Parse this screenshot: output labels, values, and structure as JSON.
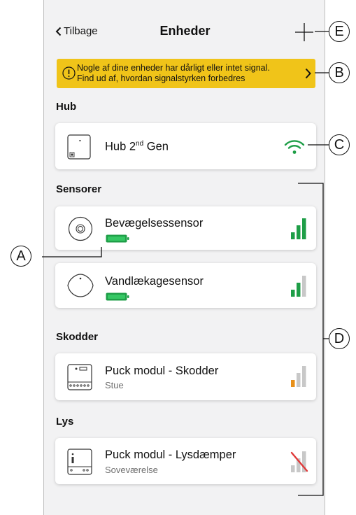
{
  "nav": {
    "back_label": "Tilbage",
    "title": "Enheder"
  },
  "banner": {
    "line1": "Nogle af dine enheder har dårligt eller intet signal.",
    "line2": "Find ud af, hvordan signalstyrken forbedres"
  },
  "sections": {
    "hub": "Hub",
    "sensors": "Sensorer",
    "shutters": "Skodder",
    "lights": "Lys"
  },
  "devices": {
    "hub": {
      "name_main": "Hub 2",
      "name_sup": "nd",
      "name_rest": " Gen",
      "signal": "wifi-strong"
    },
    "motion": {
      "name": "Bevægelsessensor",
      "battery": "full",
      "signal_bars": 3
    },
    "water": {
      "name": "Vandlækagesensor",
      "battery": "full",
      "signal_bars": 2
    },
    "shutter": {
      "name": "Puck modul - Skodder",
      "room": "Stue",
      "signal_bars": 1
    },
    "dimmer": {
      "name": "Puck modul - Lysdæmper",
      "room": "Soveværelse",
      "signal_bars": 0
    }
  },
  "callouts": {
    "a": "A",
    "b": "B",
    "c": "C",
    "d": "D",
    "e": "E"
  },
  "colors": {
    "banner": "#f0c419",
    "signal_green": "#1e9e47",
    "signal_orange": "#e8901a",
    "signal_grey": "#c8c8c8",
    "no_signal_red": "#e03a3a",
    "background": "#f2f2f3"
  }
}
